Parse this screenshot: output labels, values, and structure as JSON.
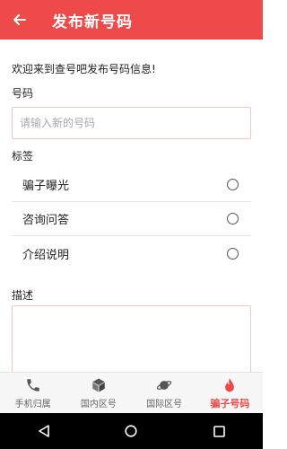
{
  "header": {
    "title": "发布新号码",
    "back_icon": "arrow-left-icon"
  },
  "form": {
    "welcome": "欢迎来到查号吧发布号码信息!",
    "number_label": "号码",
    "number_placeholder": "请输入新的号码",
    "number_value": "",
    "tags_label": "标签",
    "tags": [
      {
        "label": "骗子曝光",
        "selected": false
      },
      {
        "label": "咨询问答",
        "selected": false
      },
      {
        "label": "介绍说明",
        "selected": false
      }
    ],
    "description_label": "描述",
    "description_value": ""
  },
  "tabs": [
    {
      "label": "手机归属",
      "icon": "phone-icon",
      "active": false
    },
    {
      "label": "国内区号",
      "icon": "cube-icon",
      "active": false
    },
    {
      "label": "国际区号",
      "icon": "planet-icon",
      "active": false
    },
    {
      "label": "骗子号码",
      "icon": "flame-icon",
      "active": true
    }
  ],
  "system_nav": {
    "icons": [
      "back-triangle-icon",
      "home-circle-icon",
      "recents-square-icon"
    ]
  },
  "colors": {
    "accent": "#ef4a4a",
    "input_border": "#f2c6c6",
    "tab_inactive": "#666666"
  }
}
